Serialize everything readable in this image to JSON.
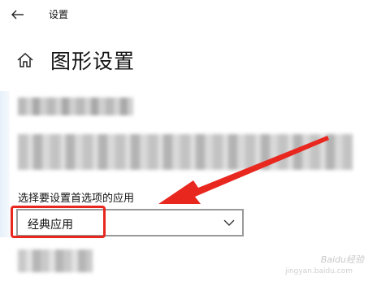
{
  "window": {
    "app_title": "设置"
  },
  "header": {
    "page_title": "图形设置"
  },
  "preference": {
    "label": "选择要设置首选项的应用",
    "selected_value": "经典应用"
  },
  "icons": {
    "back": "back-arrow-icon",
    "home": "home-icon",
    "chevron": "chevron-down-icon"
  },
  "watermark": {
    "text": "Baidu经验",
    "url_text": "jingyan.baidu.com"
  },
  "colors": {
    "annotation_red": "#e8271f",
    "select_border": "#999999"
  }
}
